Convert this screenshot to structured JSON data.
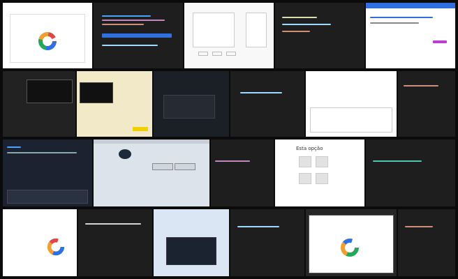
{
  "tiles": [
    {
      "title": "",
      "lines": []
    },
    {
      "title": "",
      "lines": []
    },
    {
      "title": "",
      "lines": []
    },
    {
      "title": "",
      "lines": []
    },
    {
      "title": "",
      "lines": []
    },
    {
      "title": "",
      "lines": []
    },
    {
      "title": "",
      "lines": []
    },
    {
      "title": "",
      "lines": []
    },
    {
      "title": "",
      "lines": []
    },
    {
      "title": "",
      "lines": []
    },
    {
      "title": "",
      "lines": []
    },
    {
      "title": "",
      "lines": []
    },
    {
      "title": "",
      "lines": []
    },
    {
      "title": "",
      "lines": []
    },
    {
      "title": "",
      "lines": []
    },
    {
      "title": "Esta opção",
      "lines": []
    },
    {
      "title": "",
      "lines": []
    },
    {
      "title": "",
      "lines": []
    },
    {
      "title": "",
      "lines": []
    },
    {
      "title": "",
      "lines": []
    },
    {
      "title": "",
      "lines": []
    },
    {
      "title": "",
      "lines": []
    },
    {
      "title": "",
      "lines": []
    },
    {
      "title": "",
      "lines": []
    }
  ],
  "colors": {
    "editor_bg": "#1e1e1e",
    "light_bg": "#f4f4f4",
    "white_bg": "#ffffff",
    "accent_blue": "#2f6fe0",
    "accent_green": "#26a65b",
    "accent_orange": "#f0a030",
    "accent_red": "#e04646"
  },
  "pie": {
    "slices": [
      0.3,
      0.25,
      0.2,
      0.15,
      0.1
    ],
    "slice_colors": [
      "#2f6fe0",
      "#26a65b",
      "#f0a030",
      "#e04646",
      "#8f5fd0"
    ]
  }
}
